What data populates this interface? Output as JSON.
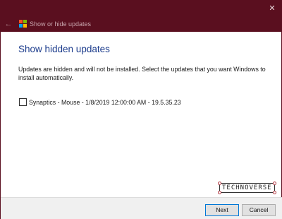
{
  "window": {
    "title": "Show or hide updates",
    "close_glyph": "✕",
    "back_glyph": "←"
  },
  "main": {
    "heading": "Show hidden updates",
    "description": "Updates are hidden and will not be installed. Select the updates that you want Windows to install automatically.",
    "updates": [
      {
        "label": "Synaptics - Mouse - 1/8/2019 12:00:00 AM - 19.5.35.23",
        "checked": false
      }
    ]
  },
  "watermark": {
    "text": "TECHNOVERSE"
  },
  "footer": {
    "next_label": "Next",
    "cancel_label": "Cancel"
  },
  "colors": {
    "titlebar": "#5a0f1f",
    "heading": "#1c3c8c",
    "accent": "#0078d7"
  },
  "icons": {
    "app": "windows-logo-icon",
    "back": "back-arrow-icon",
    "close": "close-icon"
  }
}
